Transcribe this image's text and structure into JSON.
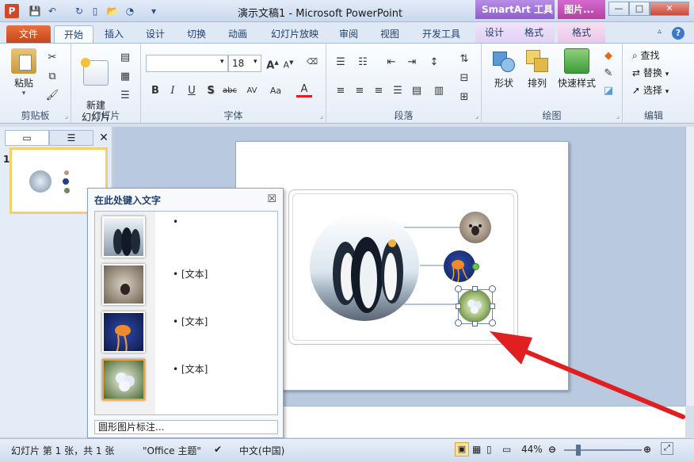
{
  "window": {
    "title": "演示文稿1 - Microsoft PowerPoint",
    "app_icon": "P",
    "contextual_groups": [
      "SmartArt 工具",
      "图片..."
    ],
    "controls": {
      "minimize": "—",
      "maximize": "□",
      "close": "✕"
    }
  },
  "tabs": [
    {
      "label": "文件"
    },
    {
      "label": "开始"
    },
    {
      "label": "插入"
    },
    {
      "label": "设计"
    },
    {
      "label": "切换"
    },
    {
      "label": "动画"
    },
    {
      "label": "幻灯片放映"
    },
    {
      "label": "审阅"
    },
    {
      "label": "视图"
    },
    {
      "label": "开发工具"
    },
    {
      "label": "设计"
    },
    {
      "label": "格式"
    },
    {
      "label": "格式"
    }
  ],
  "help": "?",
  "ribbon": {
    "clipboard": {
      "label": "剪贴板",
      "paste": "粘贴"
    },
    "slides": {
      "label": "幻灯片",
      "new_slide": "新建\n幻灯片"
    },
    "font": {
      "label": "字体",
      "font_name": "",
      "font_size": "18",
      "buttons": [
        "B",
        "I",
        "U",
        "S",
        "abc",
        "AV",
        "Aa",
        "A"
      ]
    },
    "paragraph": {
      "label": "段落"
    },
    "drawing": {
      "label": "绘图",
      "shapes": "形状",
      "arrange": "排列",
      "quick_styles": "快速样式"
    },
    "editing": {
      "label": "编辑",
      "find": "查找",
      "replace": "替换",
      "select": "选择"
    }
  },
  "thumbnails": {
    "slide_number": "1"
  },
  "text_pane": {
    "title": "在此处键入文字",
    "close": "☒",
    "items": [
      {
        "text": "",
        "thumb_icon": "penguins-image"
      },
      {
        "text": "[文本]",
        "thumb_icon": "koala-image"
      },
      {
        "text": "[文本]",
        "thumb_icon": "jellyfish-image"
      },
      {
        "text": "[文本]",
        "thumb_icon": "hydrangeas-image"
      }
    ],
    "footer": "圆形图片标注..."
  },
  "statusbar": {
    "slide_info": "幻灯片 第 1 张，共 1 张",
    "theme": "\"Office 主题\"",
    "language": "中文(中国)",
    "zoom": "44%"
  },
  "colors": {
    "accent_red": "#e02020",
    "file_tab": "#c4471b",
    "smartart_tab": "#8e5ec9",
    "picture_tab": "#b6419f"
  }
}
